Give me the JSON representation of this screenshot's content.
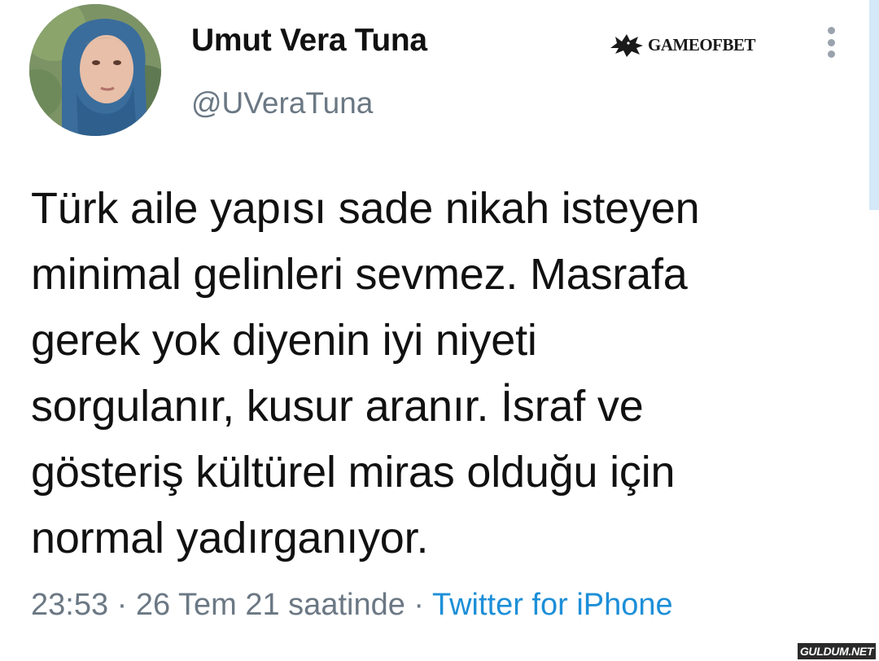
{
  "author": {
    "display_name": "Umut Vera Tuna",
    "handle": "@UVeraTuna"
  },
  "tweet": {
    "lines": [
      "Türk aile yapısı sade nikah isteyen",
      "minimal gelinleri sevmez. Masrafa",
      "gerek yok diyenin iyi niyeti",
      "sorgulanır, kusur aranır. İsraf ve",
      "gösteriş kültürel miras olduğu için",
      "normal yadırganıyor."
    ],
    "time": "23:53",
    "separator": "·",
    "date": "26 Tem 21 saatinde",
    "source": "Twitter for iPhone"
  },
  "watermarks": {
    "top": "GAMEOFBET",
    "bottom": "GULDUM.NET"
  },
  "icons": {
    "more": "more-vertical-icon",
    "wolf": "wolf-emblem-icon"
  },
  "colors": {
    "text": "#111111",
    "secondary": "#6b7884",
    "link": "#1d8fd8"
  }
}
